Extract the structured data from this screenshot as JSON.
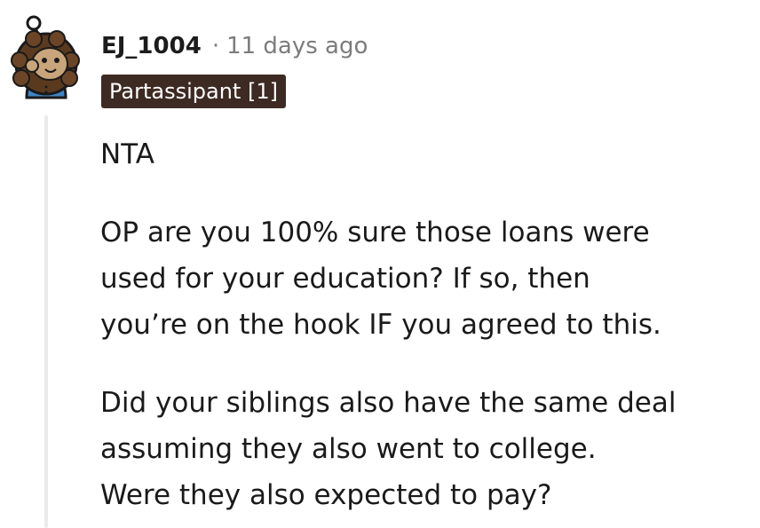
{
  "comment": {
    "username": "EJ_1004",
    "separator": "·",
    "timestamp": "11 days ago",
    "flair": "Partassipant [1]",
    "avatar_icon": "snoo-avatar-icon",
    "paragraphs": [
      {
        "lines": [
          "NTA"
        ]
      },
      {
        "lines": [
          "OP are you 100% sure those loans were",
          "used for your education? If so, then",
          "you’re on the hook IF you agreed to this."
        ]
      },
      {
        "lines": [
          "Did your siblings also have the same deal",
          "assuming they also went to college.",
          "Were they also expected to pay?"
        ]
      }
    ]
  },
  "colors": {
    "flair_bg": "#3d2a22",
    "meta_text": "#7c7c7c",
    "thread_line": "#ebebeb",
    "avatar_bg": "#ffffff",
    "avatar_hair": "#5a3a1f",
    "avatar_skin": "#c8a57a",
    "avatar_shirt": "#3d86c6"
  }
}
